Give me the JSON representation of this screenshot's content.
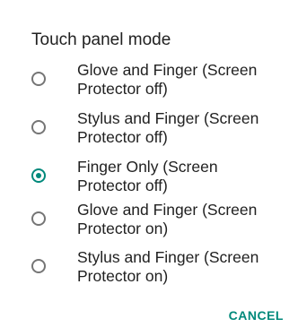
{
  "dialog": {
    "title": "Touch panel mode",
    "options": [
      {
        "label": "Glove and Finger (Screen Protector off)",
        "selected": false
      },
      {
        "label": "Stylus and Finger (Screen Protector off)",
        "selected": false
      },
      {
        "label": "Finger Only (Screen Protector off)",
        "selected": true
      },
      {
        "label": "Glove and Finger (Screen Protector on)",
        "selected": false
      },
      {
        "label": "Stylus and Finger (Screen Protector on)",
        "selected": false
      }
    ],
    "cancel_label": "CANCEL"
  },
  "colors": {
    "accent": "#00897b",
    "text": "#212121",
    "radio_unchecked": "#757575"
  }
}
